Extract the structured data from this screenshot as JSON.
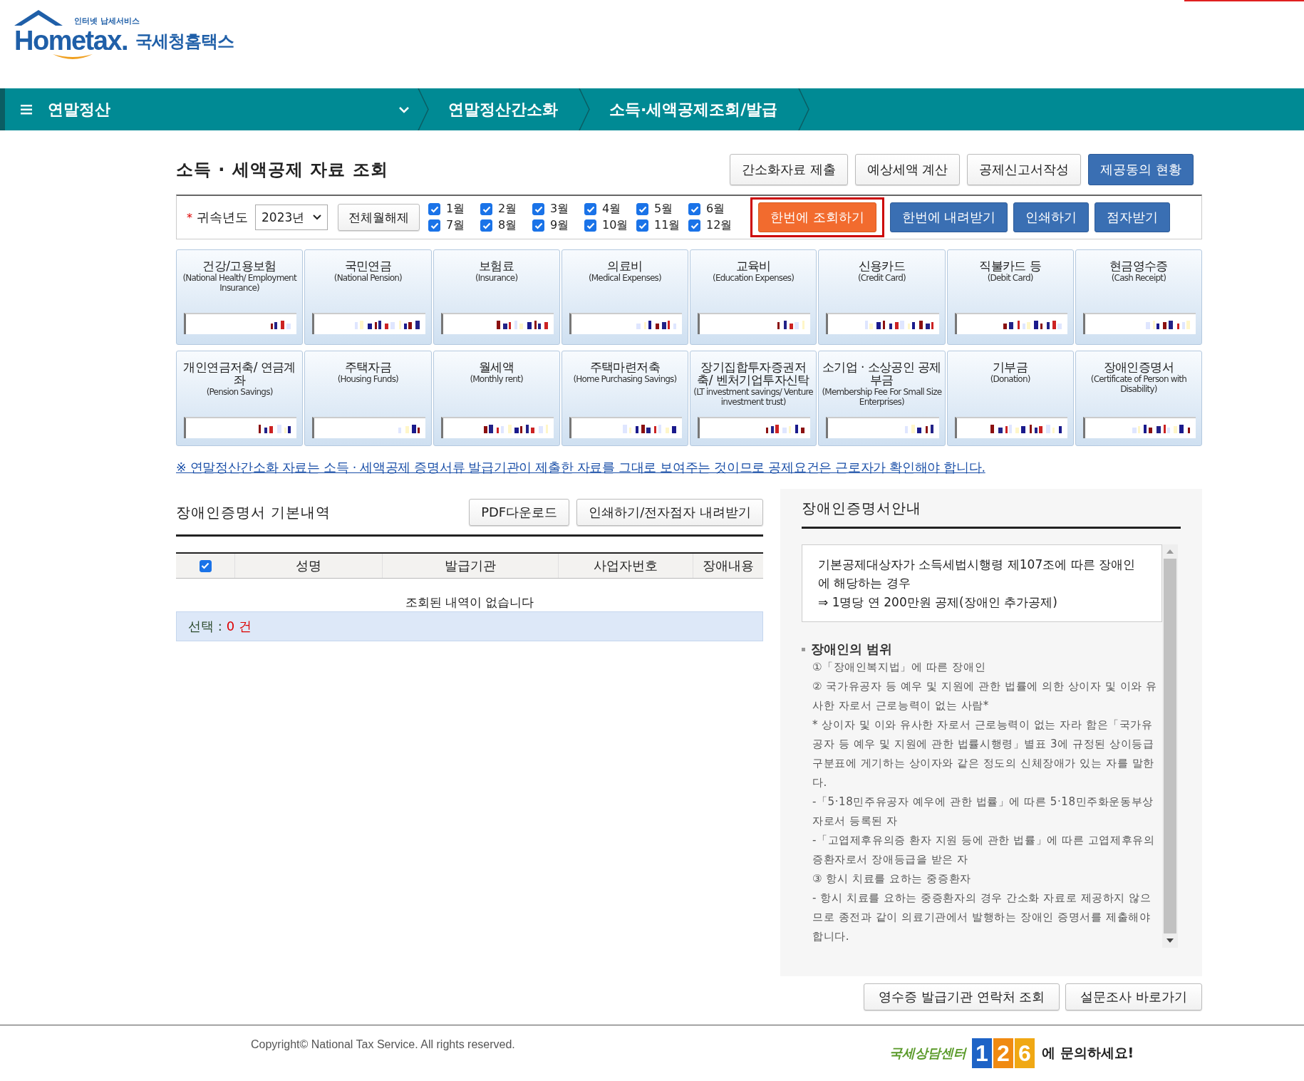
{
  "logo": {
    "tagline": "인터넷 납세서비스",
    "wordmark": "Hometax.",
    "name": "국세청홈택스"
  },
  "nav": {
    "items": [
      {
        "label": "연말정산",
        "kind": "dropdown"
      },
      {
        "label": "연말정산간소화",
        "kind": "crumb"
      },
      {
        "label": "소득·세액공제조회/발급",
        "kind": "crumb"
      }
    ]
  },
  "page_title": "소득 · 세액공제 자료 조회",
  "top_buttons": [
    {
      "label": "간소화자료 제출",
      "primary": false
    },
    {
      "label": "예상세액 계산",
      "primary": false
    },
    {
      "label": "공제신고서작성",
      "primary": false
    },
    {
      "label": "제공동의 현황",
      "primary": true
    }
  ],
  "filter": {
    "required_mark": "*",
    "year_label": "귀속년도",
    "year_value": "2023년",
    "clear_button": "전체월해제",
    "months": [
      {
        "label": "1월",
        "checked": true
      },
      {
        "label": "2월",
        "checked": true
      },
      {
        "label": "3월",
        "checked": true
      },
      {
        "label": "4월",
        "checked": true
      },
      {
        "label": "5월",
        "checked": true
      },
      {
        "label": "6월",
        "checked": true
      },
      {
        "label": "7월",
        "checked": true
      },
      {
        "label": "8월",
        "checked": true
      },
      {
        "label": "9월",
        "checked": true
      },
      {
        "label": "10월",
        "checked": true
      },
      {
        "label": "11월",
        "checked": true
      },
      {
        "label": "12월",
        "checked": true
      }
    ],
    "actions": [
      {
        "label": "한번에 조회하기",
        "kind": "highlighted"
      },
      {
        "label": "한번에 내려받기",
        "kind": "primary"
      },
      {
        "label": "인쇄하기",
        "kind": "primary"
      },
      {
        "label": "점자받기",
        "kind": "primary"
      }
    ]
  },
  "categories": [
    {
      "title": "건강/고용보험",
      "subtitle": "(National Health/ Employment Insurance)"
    },
    {
      "title": "국민연금",
      "subtitle": "(National Pension)"
    },
    {
      "title": "보험료",
      "subtitle": "(Insurance)"
    },
    {
      "title": "의료비",
      "subtitle": "(Medical Expenses)"
    },
    {
      "title": "교육비",
      "subtitle": "(Education Expenses)"
    },
    {
      "title": "신용카드",
      "subtitle": "(Credit Card)"
    },
    {
      "title": "직불카드 등",
      "subtitle": "(Debit Card)"
    },
    {
      "title": "현금영수증",
      "subtitle": "(Cash Receipt)"
    },
    {
      "title": "개인연금저축/ 연금계좌",
      "subtitle": "(Pension Savings)"
    },
    {
      "title": "주택자금",
      "subtitle": "(Housing Funds)"
    },
    {
      "title": "월세액",
      "subtitle": "(Monthly rent)"
    },
    {
      "title": "주택마련저축",
      "subtitle": "(Home Purchasing Savings)"
    },
    {
      "title": "장기집합투자증권저축/ 벤처기업투자신탁",
      "subtitle": "(LT investment savings/ Venture investment trust)"
    },
    {
      "title": "소기업 · 소상공인 공제부금",
      "subtitle": "(Membership Fee For Small Size Enterprises)"
    },
    {
      "title": "기부금",
      "subtitle": "(Donation)"
    },
    {
      "title": "장애인증명서",
      "subtitle": "(Certificate of Person with Disability)"
    }
  ],
  "notice": "※ 연말정산간소화 자료는 소득 · 세액공제 증명서류 발급기관이 제출한 자료를 그대로 보여주는 것이므로 공제요건은 근로자가 확인해야 합니다.",
  "detail": {
    "title": "장애인증명서 기본내역",
    "buttons": [
      "PDF다운로드",
      "인쇄하기/전자점자 내려받기"
    ],
    "table": {
      "select_all_checked": true,
      "columns": [
        "성명",
        "발급기관",
        "사업자번호",
        "장애내용"
      ],
      "empty_message": "조회된 내역이 없습니다"
    },
    "summary": {
      "label": "선택 :",
      "count": "0 건"
    }
  },
  "guide": {
    "title": "장애인증명서안내",
    "intro": [
      "기본공제대상자가 소득세법시행령 제107조에 따른 장애인에 해당하는 경우",
      "⇒ 1명당 연 200만원 공제(장애인 추가공제)"
    ],
    "section_title": "장애인의 범위",
    "paragraphs": [
      "①「장애인복지법」에 따른 장애인",
      "② 국가유공자 등 예우 및 지원에 관한 법률에 의한 상이자 및 이와 유사한 자로서 근로능력이 없는 사람*",
      "* 상이자 및 이와 유사한 자로서 근로능력이 없는 자라 함은「국가유공자 등 예우 및 지원에 관한 법률시행령」별표 3에 규정된 상이등급구분표에 게기하는 상이자와 같은 정도의 신체장애가 있는 자를 말한다.",
      "-「5·18민주유공자 예우에 관한 법률」에 따른 5·18민주화운동부상자로서 등록된 자",
      "-「고엽제후유의증 환자 지원 등에 관한 법률」에 따른 고엽제후유의증환자로서 장애등급을 받은 자",
      "③ 항시 치료를 요하는 중증환자",
      "- 항시 치료를 요하는 중증환자의 경우 간소화 자료로 제공하지 않으므로 종전과 같이 의료기관에서 발행하는 장애인 증명서를 제출해야 합니다."
    ]
  },
  "bottom_buttons": [
    "영수증 발급기관 연락처 조회",
    "설문조사 바로가기"
  ],
  "footer": {
    "copyright": "Copyright© National Tax Service. All rights reserved.",
    "center_label": "국세상담센터",
    "digits": [
      "1",
      "2",
      "6"
    ],
    "suffix": "에 문의하세요!"
  }
}
